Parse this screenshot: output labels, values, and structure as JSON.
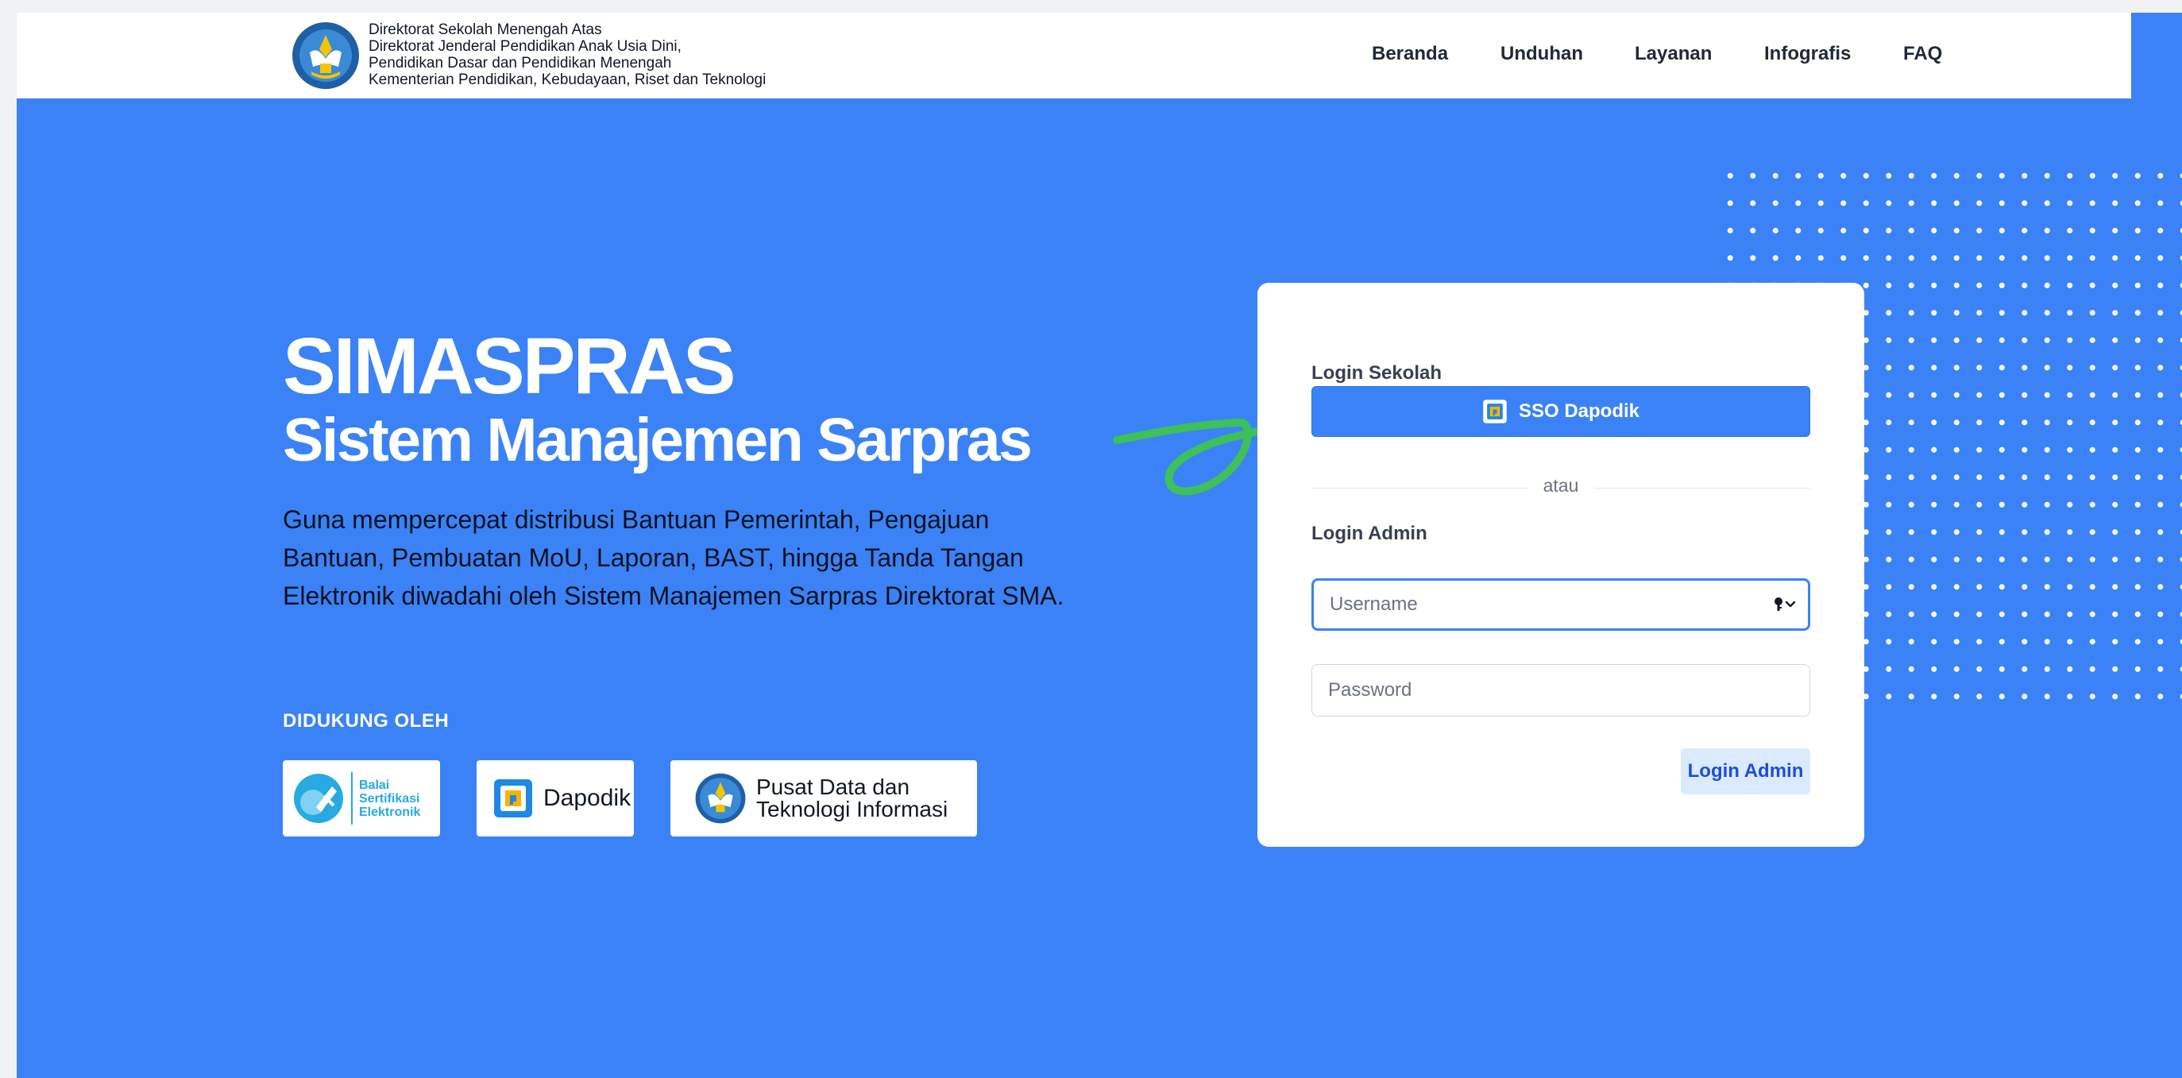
{
  "header": {
    "org_lines": [
      "Direktorat Sekolah Menengah Atas",
      "Direktorat Jenderal Pendidikan Anak Usia Dini,",
      "Pendidikan Dasar dan Pendidikan Menengah",
      "Kementerian Pendidikan, Kebudayaan, Riset dan Teknologi"
    ],
    "nav": [
      "Beranda",
      "Unduhan",
      "Layanan",
      "Infografis",
      "FAQ"
    ]
  },
  "hero": {
    "title": "SIMASPRAS",
    "subtitle": "Sistem Manajemen Sarpras",
    "description": "Guna mempercepat distribusi Bantuan Pemerintah, Pengajuan Bantuan, Pembuatan MoU, Laporan, BAST, hingga Tanda Tangan Elektronik diwadahi oleh Sistem Manajemen Sarpras Direktorat SMA.",
    "supported_by": "DIDUKUNG OLEH"
  },
  "partners": {
    "bsre": [
      "Balai",
      "Sertifikasi",
      "Elektronik"
    ],
    "dapodik": "Dapodik",
    "pusdatin": [
      "Pusat Data dan",
      "Teknologi Informasi"
    ]
  },
  "login": {
    "school_label": "Login Sekolah",
    "sso_button": "SSO Dapodik",
    "separator": "atau",
    "admin_label": "Login Admin",
    "username_placeholder": "Username",
    "password_placeholder": "Password",
    "admin_button": "Login Admin"
  },
  "colors": {
    "primary": "#3b82f6",
    "arrow": "#3ec05a",
    "admin_button_bg": "#dbeafe",
    "admin_button_text": "#1d4ed8"
  },
  "icons": {
    "ministry_logo": "tut-wuri-handayani-logo",
    "sso": "dapodik-icon",
    "username_field": "key-dropdown-icon"
  }
}
